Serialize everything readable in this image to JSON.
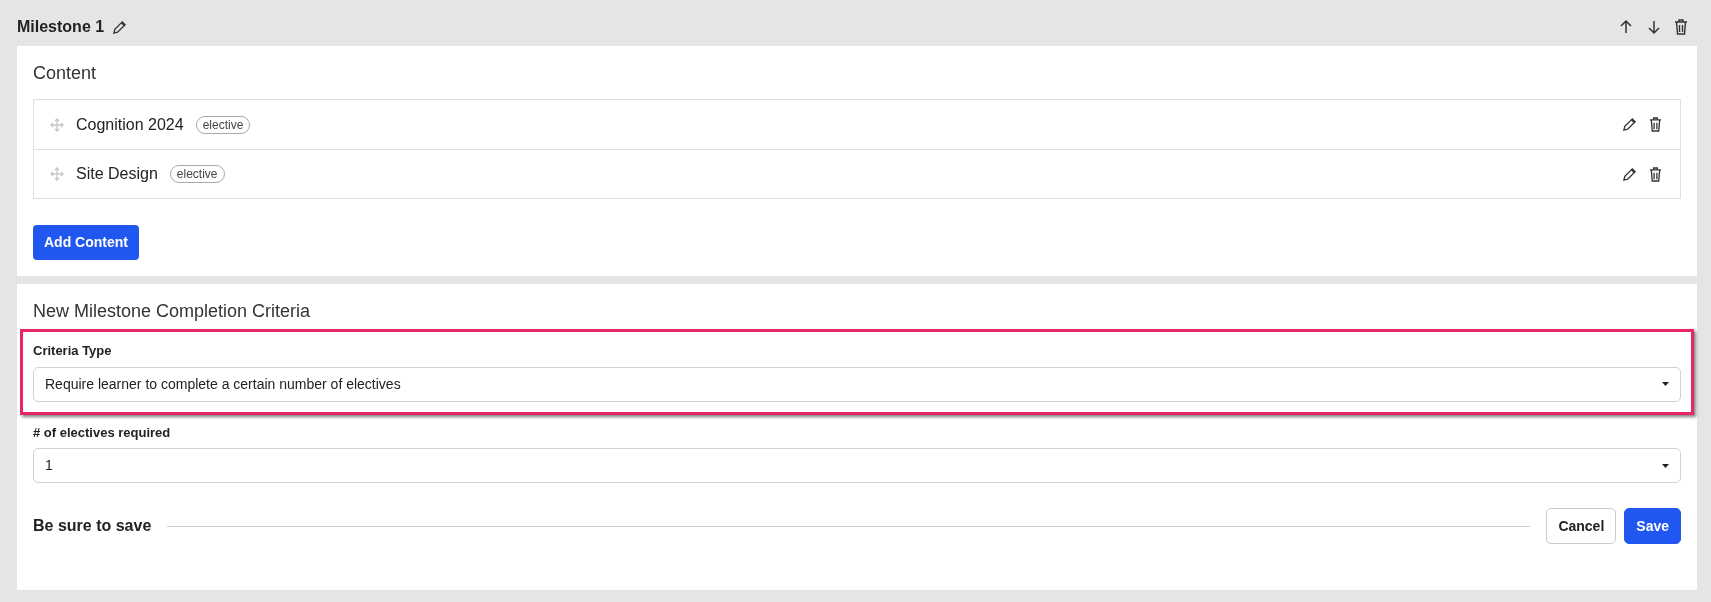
{
  "milestone": {
    "title": "Milestone 1"
  },
  "content": {
    "heading": "Content",
    "items": [
      {
        "name": "Cognition 2024",
        "tag": "elective"
      },
      {
        "name": "Site Design",
        "tag": "elective"
      }
    ],
    "add_button": "Add Content"
  },
  "criteria": {
    "heading": "New Milestone Completion Criteria",
    "fields": [
      {
        "label": "Criteria Type",
        "value": "Require learner to complete a certain number of electives",
        "highlighted": true
      },
      {
        "label": "# of electives required",
        "value": "1",
        "highlighted": false
      }
    ],
    "save_note": "Be sure to save",
    "buttons": [
      {
        "label": "Cancel",
        "kind": "secondary"
      },
      {
        "label": "Save",
        "kind": "primary"
      }
    ]
  }
}
